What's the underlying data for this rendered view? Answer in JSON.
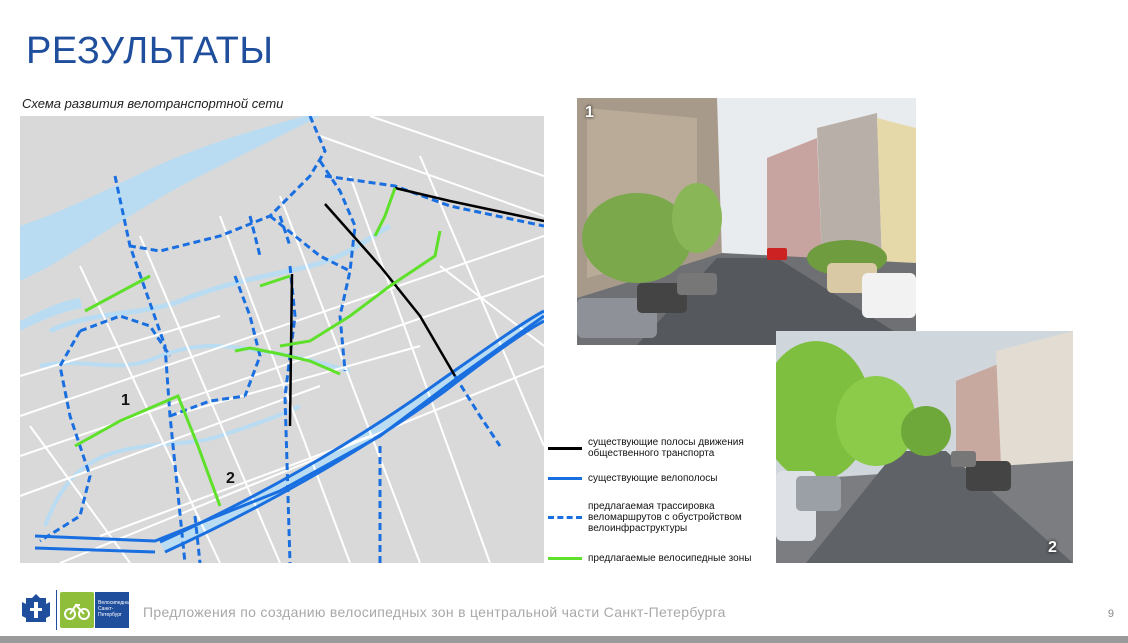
{
  "slide": {
    "title": "РЕЗУЛЬТАТЫ",
    "subtitle": "Схема развития велотранспортной сети",
    "page_number": "9",
    "footer_text": "Предложения по созданию велосипедных зон в центральной части Санкт-Петербурга"
  },
  "map": {
    "zone_label_1": "1",
    "zone_label_2": "2"
  },
  "legend": {
    "items": [
      {
        "label_line1": "существующие полосы движения",
        "label_line2": "общественного транспорта",
        "color": "#000000",
        "style": "solid"
      },
      {
        "label_line1": "существующие велополосы",
        "label_line2": "",
        "color": "#1a6fe0",
        "style": "solid"
      },
      {
        "label_line1": "предлагаемая трассировка",
        "label_line2": "веломаршрутов с обустройством",
        "label_line3": "велоинфраструктуры",
        "color": "#1a6fe0",
        "style": "dashed"
      },
      {
        "label_line1": "предлагаемые велосипедные зоны",
        "label_line2": "",
        "color": "#5fe02a",
        "style": "solid"
      }
    ]
  },
  "photos": {
    "photo1_label": "1",
    "photo2_label": "2"
  },
  "logos": {
    "bike_logo_line1": "Велосипедная",
    "bike_logo_line2": "Санкт-",
    "bike_logo_line3": "Петербург"
  },
  "colors": {
    "title": "#1f4e9c",
    "map_bg": "#d9d9d9",
    "road": "#ffffff",
    "water": "#b9dcf2",
    "transit": "#000000",
    "bike_lane": "#1a6fe0",
    "zone": "#5fe02a"
  }
}
